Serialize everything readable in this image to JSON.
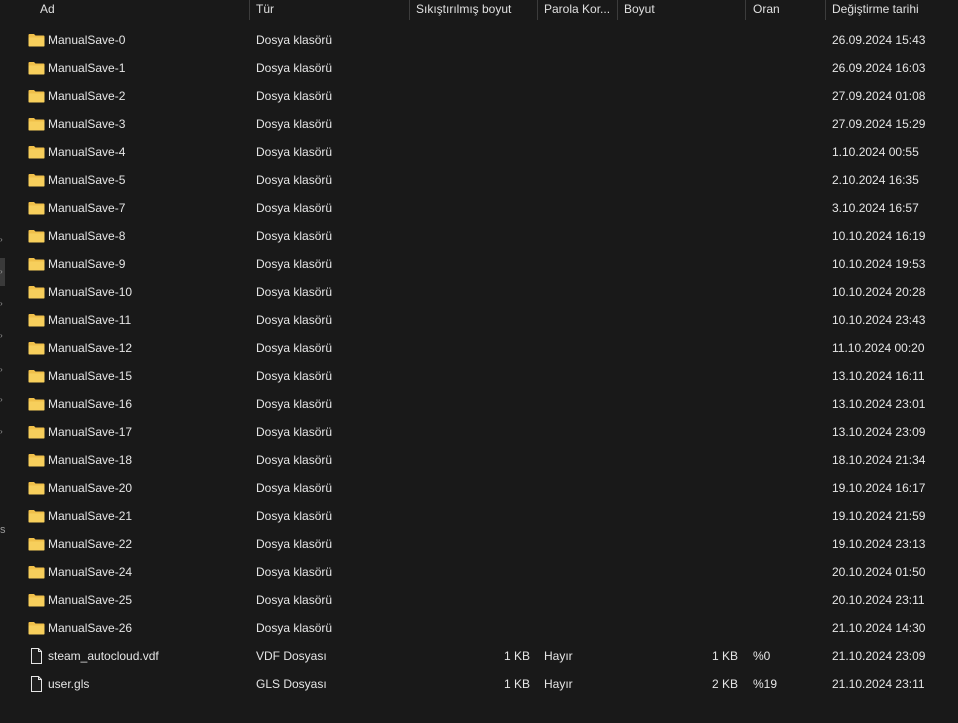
{
  "columns": {
    "name": "Ad",
    "type": "Tür",
    "compressed": "Sıkıştırılmış boyut",
    "password": "Parola Kor...",
    "size": "Boyut",
    "ratio": "Oran",
    "modified": "Değiştirme tarihi"
  },
  "gutter": {
    "mark": "s"
  },
  "icons": {
    "folder": "folder-icon",
    "file": "file-icon",
    "folder_color": "#f0c04a"
  },
  "files": [
    {
      "name": "ManualSave-0",
      "type": "Dosya klasörü",
      "compressed": "",
      "password": "",
      "size": "",
      "ratio": "",
      "modified": "26.09.2024 15:43",
      "icon": "folder"
    },
    {
      "name": "ManualSave-1",
      "type": "Dosya klasörü",
      "compressed": "",
      "password": "",
      "size": "",
      "ratio": "",
      "modified": "26.09.2024 16:03",
      "icon": "folder"
    },
    {
      "name": "ManualSave-2",
      "type": "Dosya klasörü",
      "compressed": "",
      "password": "",
      "size": "",
      "ratio": "",
      "modified": "27.09.2024 01:08",
      "icon": "folder"
    },
    {
      "name": "ManualSave-3",
      "type": "Dosya klasörü",
      "compressed": "",
      "password": "",
      "size": "",
      "ratio": "",
      "modified": "27.09.2024 15:29",
      "icon": "folder"
    },
    {
      "name": "ManualSave-4",
      "type": "Dosya klasörü",
      "compressed": "",
      "password": "",
      "size": "",
      "ratio": "",
      "modified": "1.10.2024 00:55",
      "icon": "folder"
    },
    {
      "name": "ManualSave-5",
      "type": "Dosya klasörü",
      "compressed": "",
      "password": "",
      "size": "",
      "ratio": "",
      "modified": "2.10.2024 16:35",
      "icon": "folder"
    },
    {
      "name": "ManualSave-7",
      "type": "Dosya klasörü",
      "compressed": "",
      "password": "",
      "size": "",
      "ratio": "",
      "modified": "3.10.2024 16:57",
      "icon": "folder"
    },
    {
      "name": "ManualSave-8",
      "type": "Dosya klasörü",
      "compressed": "",
      "password": "",
      "size": "",
      "ratio": "",
      "modified": "10.10.2024 16:19",
      "icon": "folder"
    },
    {
      "name": "ManualSave-9",
      "type": "Dosya klasörü",
      "compressed": "",
      "password": "",
      "size": "",
      "ratio": "",
      "modified": "10.10.2024 19:53",
      "icon": "folder"
    },
    {
      "name": "ManualSave-10",
      "type": "Dosya klasörü",
      "compressed": "",
      "password": "",
      "size": "",
      "ratio": "",
      "modified": "10.10.2024 20:28",
      "icon": "folder"
    },
    {
      "name": "ManualSave-11",
      "type": "Dosya klasörü",
      "compressed": "",
      "password": "",
      "size": "",
      "ratio": "",
      "modified": "10.10.2024 23:43",
      "icon": "folder"
    },
    {
      "name": "ManualSave-12",
      "type": "Dosya klasörü",
      "compressed": "",
      "password": "",
      "size": "",
      "ratio": "",
      "modified": "11.10.2024 00:20",
      "icon": "folder"
    },
    {
      "name": "ManualSave-15",
      "type": "Dosya klasörü",
      "compressed": "",
      "password": "",
      "size": "",
      "ratio": "",
      "modified": "13.10.2024 16:11",
      "icon": "folder"
    },
    {
      "name": "ManualSave-16",
      "type": "Dosya klasörü",
      "compressed": "",
      "password": "",
      "size": "",
      "ratio": "",
      "modified": "13.10.2024 23:01",
      "icon": "folder"
    },
    {
      "name": "ManualSave-17",
      "type": "Dosya klasörü",
      "compressed": "",
      "password": "",
      "size": "",
      "ratio": "",
      "modified": "13.10.2024 23:09",
      "icon": "folder"
    },
    {
      "name": "ManualSave-18",
      "type": "Dosya klasörü",
      "compressed": "",
      "password": "",
      "size": "",
      "ratio": "",
      "modified": "18.10.2024 21:34",
      "icon": "folder"
    },
    {
      "name": "ManualSave-20",
      "type": "Dosya klasörü",
      "compressed": "",
      "password": "",
      "size": "",
      "ratio": "",
      "modified": "19.10.2024 16:17",
      "icon": "folder"
    },
    {
      "name": "ManualSave-21",
      "type": "Dosya klasörü",
      "compressed": "",
      "password": "",
      "size": "",
      "ratio": "",
      "modified": "19.10.2024 21:59",
      "icon": "folder"
    },
    {
      "name": "ManualSave-22",
      "type": "Dosya klasörü",
      "compressed": "",
      "password": "",
      "size": "",
      "ratio": "",
      "modified": "19.10.2024 23:13",
      "icon": "folder"
    },
    {
      "name": "ManualSave-24",
      "type": "Dosya klasörü",
      "compressed": "",
      "password": "",
      "size": "",
      "ratio": "",
      "modified": "20.10.2024 01:50",
      "icon": "folder"
    },
    {
      "name": "ManualSave-25",
      "type": "Dosya klasörü",
      "compressed": "",
      "password": "",
      "size": "",
      "ratio": "",
      "modified": "20.10.2024 23:11",
      "icon": "folder"
    },
    {
      "name": "ManualSave-26",
      "type": "Dosya klasörü",
      "compressed": "",
      "password": "",
      "size": "",
      "ratio": "",
      "modified": "21.10.2024 14:30",
      "icon": "folder"
    },
    {
      "name": "steam_autocloud.vdf",
      "type": "VDF Dosyası",
      "compressed": "1 KB",
      "password": "Hayır",
      "size": "1 KB",
      "ratio": "%0",
      "modified": "21.10.2024 23:09",
      "icon": "file"
    },
    {
      "name": "user.gls",
      "type": "GLS Dosyası",
      "compressed": "1 KB",
      "password": "Hayır",
      "size": "2 KB",
      "ratio": "%19",
      "modified": "21.10.2024 23:11",
      "icon": "file"
    }
  ]
}
